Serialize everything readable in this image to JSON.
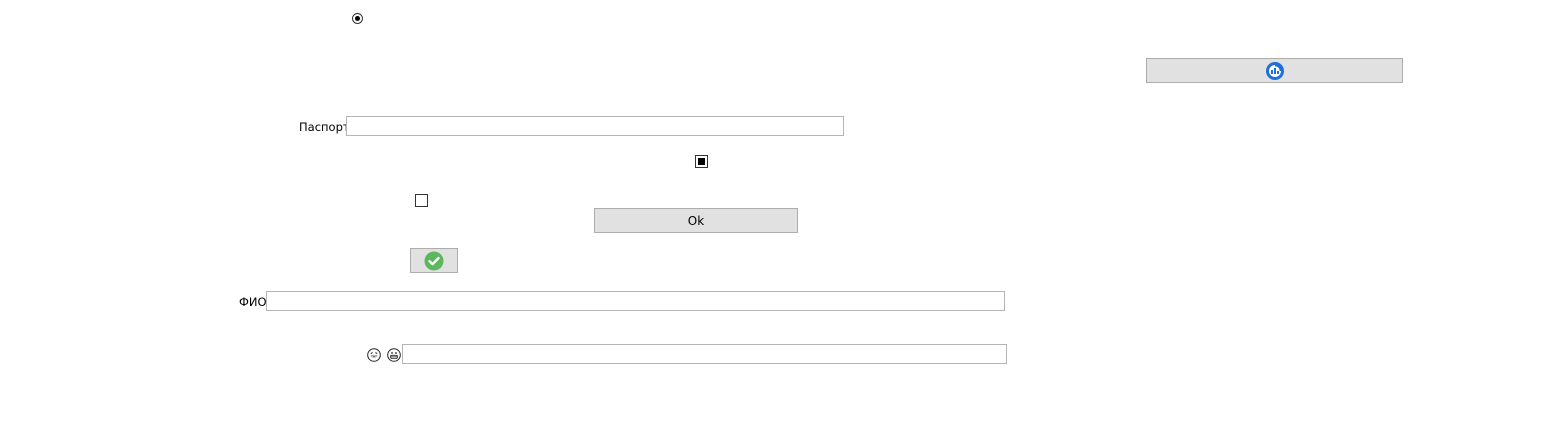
{
  "form": {
    "passport_label": "Паспорт",
    "passport_value": "",
    "fio_label": "ФИО",
    "fio_value": "",
    "emoji_field_value": "",
    "ok_button_label": "Ok"
  },
  "controls": {
    "radio_checked": true,
    "checkbox_filled": "indeterminate",
    "checkbox_empty": "unchecked"
  },
  "icons": {
    "refresh_button_icon": "refresh-icon",
    "check_button_icon": "check-icon",
    "emoji_left": "laughing-face-icon",
    "emoji_right": "grinning-face-icon"
  },
  "colors": {
    "button_bg": "#e1e1e1",
    "check_green": "#5cb85c",
    "refresh_blue": "#1e6fd9"
  }
}
